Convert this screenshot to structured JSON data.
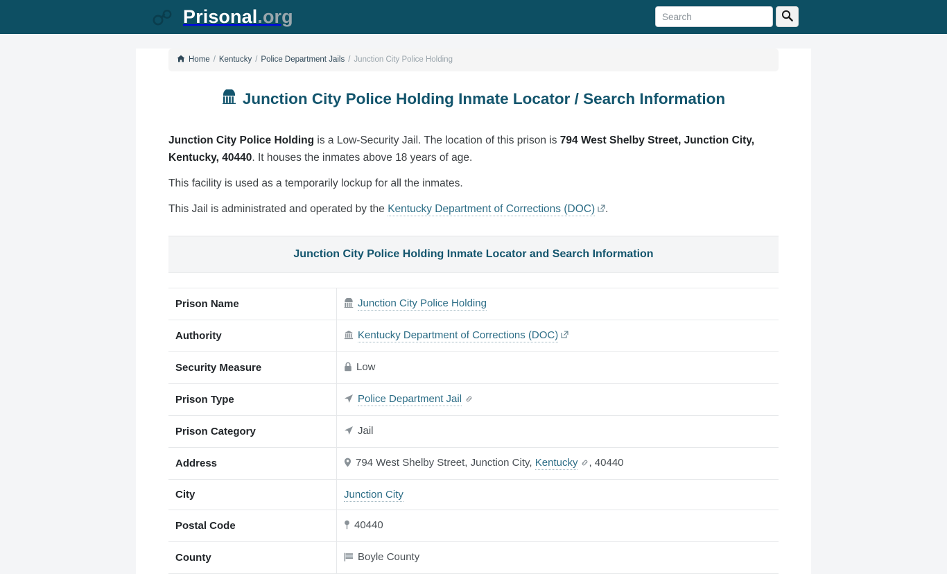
{
  "header": {
    "brand_name": "Prisonal",
    "brand_tld": ".org",
    "brand_icon": "handcuffs-icon",
    "search": {
      "placeholder": "Search",
      "value": "",
      "button_icon": "search-icon"
    },
    "background_color": "#0d4f63"
  },
  "breadcrumb": {
    "home_icon": "home-icon",
    "items": [
      {
        "label": "Home",
        "current": false
      },
      {
        "label": "Kentucky",
        "current": false
      },
      {
        "label": "Police Department Jails",
        "current": false
      },
      {
        "label": "Junction City Police Holding",
        "current": true
      }
    ],
    "separator": "/"
  },
  "main": {
    "title_icon": "jail-building-icon",
    "title": "Junction City Police Holding Inmate Locator / Search Information",
    "paragraph1": {
      "facility_name": "Junction City Police Holding",
      "text_part1": " is a Low-Security Jail. The location of this prison is ",
      "address_bold": "794 West Shelby Street, Junction City, Kentucky, 40440",
      "text_part2": ". It houses the inmates above 18 years of age."
    },
    "paragraph2": "This facility is used as a temporarily lockup for all the inmates.",
    "paragraph3": {
      "text_before": "This Jail is administrated and operated by the ",
      "link_label": "Kentucky Department of Corrections (DOC)",
      "link_icon": "external-link-icon",
      "text_after": "."
    },
    "table_caption": "Junction City Police Holding Inmate Locator and Search Information",
    "table_rows": [
      {
        "label": "Prison Name",
        "icon": "jail-building-icon",
        "value": "Junction City Police Holding",
        "is_link": true,
        "suffix_icon": ""
      },
      {
        "label": "Authority",
        "icon": "bank-building-icon",
        "value": "Kentucky Department of Corrections (DOC)",
        "is_link": true,
        "suffix_icon": "external-link-icon"
      },
      {
        "label": "Security Measure",
        "icon": "lock-icon",
        "value": "Low",
        "is_link": false,
        "suffix_icon": ""
      },
      {
        "label": "Prison Type",
        "icon": "location-arrow-icon",
        "value": "Police Department Jail",
        "is_link": true,
        "suffix_icon": "chain-link-icon"
      },
      {
        "label": "Prison Category",
        "icon": "location-arrow-icon",
        "value": "Jail",
        "is_link": false,
        "suffix_icon": ""
      },
      {
        "label": "Address",
        "icon": "map-marker-icon",
        "value_prefix": "794 West Shelby Street, Junction City, ",
        "value_link": "Kentucky",
        "suffix_icon": "chain-link-icon",
        "value_suffix": ", 40440",
        "is_link": false
      },
      {
        "label": "City",
        "icon": "",
        "value": "Junction City",
        "is_link": true,
        "suffix_icon": ""
      },
      {
        "label": "Postal Code",
        "icon": "map-pin-icon",
        "value": "40440",
        "is_link": false,
        "suffix_icon": ""
      },
      {
        "label": "County",
        "icon": "flag-icon",
        "value": "Boyle County",
        "is_link": false,
        "suffix_icon": ""
      }
    ]
  },
  "colors": {
    "brand_dark": "#0d4f63",
    "heading": "#13556d",
    "link": "#2c6d86",
    "muted": "#9aa5ac"
  }
}
